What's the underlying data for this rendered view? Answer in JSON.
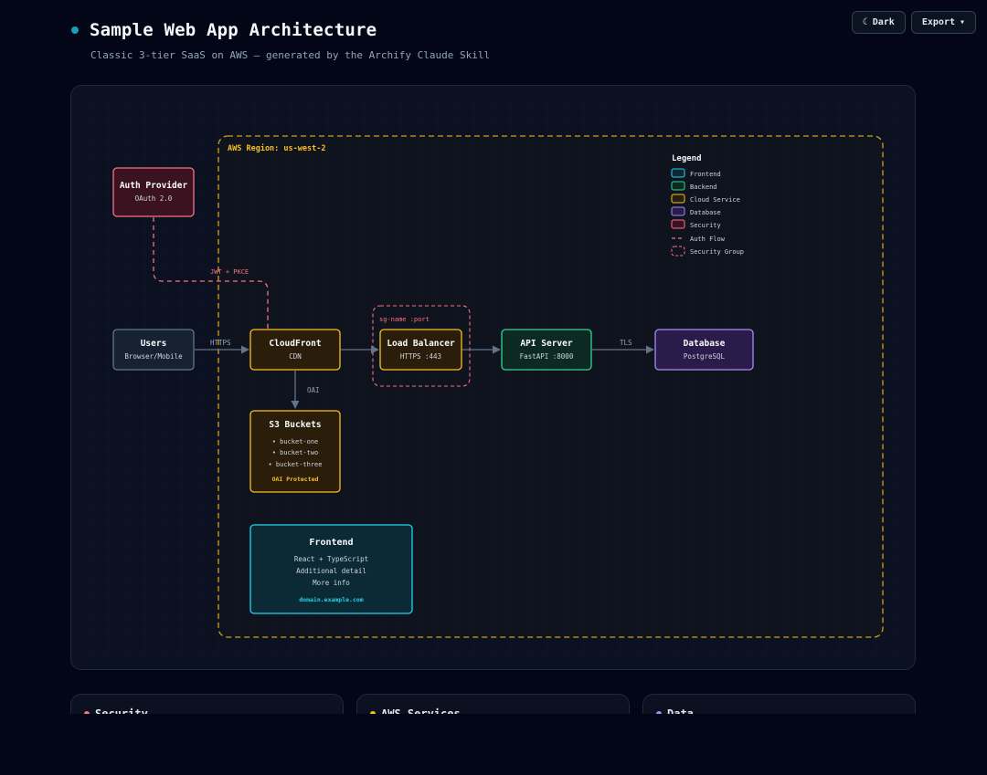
{
  "header": {
    "title": "Sample Web App Architecture",
    "subtitle": "Classic 3-tier SaaS on AWS — generated by the Archify Claude Skill"
  },
  "toolbar": {
    "dark_label": "Dark",
    "dark_icon": "moon-icon",
    "export_label": "Export",
    "export_icon": "chevron-down-icon"
  },
  "colors": {
    "frontend": "#22d3ee",
    "backend": "#34d399",
    "cloud": "#fbbf24",
    "database": "#a78bfa",
    "security": "#fb7185",
    "edge": "#64748b"
  },
  "region": {
    "label": "AWS Region: us-west-2"
  },
  "security_group": {
    "label": "sg-name :port"
  },
  "legend": {
    "title": "Legend",
    "items": [
      {
        "label": "Frontend",
        "kind": "frontend"
      },
      {
        "label": "Backend",
        "kind": "backend"
      },
      {
        "label": "Cloud Service",
        "kind": "cloud"
      },
      {
        "label": "Database",
        "kind": "database"
      },
      {
        "label": "Security",
        "kind": "security"
      },
      {
        "label": "Auth Flow",
        "kind": "auth-flow"
      },
      {
        "label": "Security Group",
        "kind": "security-group"
      }
    ]
  },
  "nodes": {
    "auth": {
      "title": "Auth Provider",
      "sub": "OAuth 2.0"
    },
    "users": {
      "title": "Users",
      "sub": "Browser/Mobile"
    },
    "cdn": {
      "title": "CloudFront",
      "sub": "CDN"
    },
    "lb": {
      "title": "Load Balancer",
      "sub": "HTTPS :443"
    },
    "api": {
      "title": "API Server",
      "sub": "FastAPI :8000"
    },
    "db": {
      "title": "Database",
      "sub": "PostgreSQL"
    },
    "s3": {
      "title": "S3 Buckets",
      "items": [
        "• bucket-one",
        "• bucket-two",
        "• bucket-three"
      ],
      "note": "OAI Protected"
    },
    "frontend": {
      "title": "Frontend",
      "lines": [
        "React + TypeScript",
        "Additional detail",
        "More info"
      ],
      "note": "domain.example.com"
    }
  },
  "edges": {
    "users_cdn": "HTTPS",
    "auth_cdn": "JWT + PKCE",
    "cdn_s3": "OAI",
    "api_db": "TLS"
  },
  "summary_cards": [
    {
      "title": "Security",
      "kind": "security"
    },
    {
      "title": "AWS Services",
      "kind": "cloud"
    },
    {
      "title": "Data",
      "kind": "database"
    }
  ]
}
